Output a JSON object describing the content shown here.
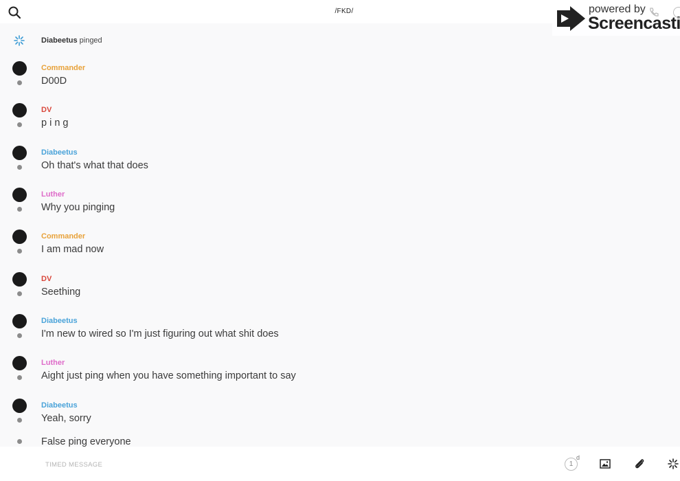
{
  "header": {
    "channel_title": "/FKD/",
    "search_icon": "search-icon"
  },
  "watermark": {
    "powered_by": "powered by",
    "brand": "Screencastify"
  },
  "ping_event": {
    "user": "Diabeetus",
    "action": " pinged",
    "icon": "ping-burst-icon",
    "icon_color": "#3a9bd5"
  },
  "messages": [
    {
      "author": "Commander",
      "color": "#e8a23a",
      "text": "D00D"
    },
    {
      "author": "DV",
      "color": "#d9473b",
      "text": "p i n g"
    },
    {
      "author": "Diabeetus",
      "color": "#4aa3d9",
      "text": "Oh that's what that does"
    },
    {
      "author": "Luther",
      "color": "#de6cc9",
      "text": "Why you pinging"
    },
    {
      "author": "Commander",
      "color": "#e8a23a",
      "text": "I am mad now"
    },
    {
      "author": "DV",
      "color": "#d9473b",
      "text": "Seething"
    },
    {
      "author": "Diabeetus",
      "color": "#4aa3d9",
      "text": "I'm new to wired so I'm just figuring out what shit does"
    },
    {
      "author": "Luther",
      "color": "#de6cc9",
      "text": "Aight just ping when you have something important to say"
    },
    {
      "author": "Diabeetus",
      "color": "#4aa3d9",
      "text": "Yeah, sorry"
    }
  ],
  "continuation": {
    "text": "False ping everyone"
  },
  "composer": {
    "placeholder": "TIMED MESSAGE",
    "timer_value": "1",
    "timer_unit": "d",
    "image_icon": "image-icon",
    "attach_icon": "paperclip-icon",
    "ping_icon": "ping-burst-icon"
  }
}
